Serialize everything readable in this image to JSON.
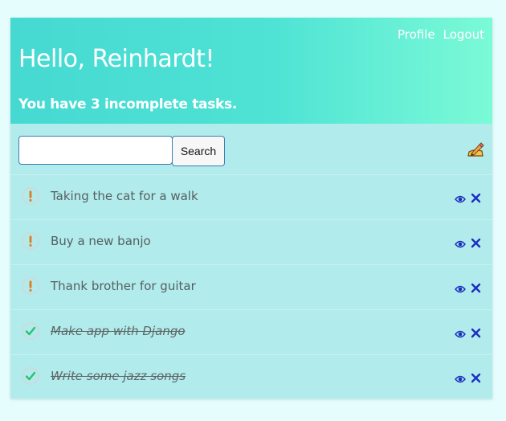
{
  "header": {
    "greeting": "Hello, Reinhardt!",
    "summary": "You have 3 incomplete tasks.",
    "nav": {
      "profile": "Profile",
      "logout": "Logout"
    }
  },
  "search": {
    "value": "",
    "button_label": "Search"
  },
  "toolbar": {
    "edit_icon": "pencil-edit-icon"
  },
  "tasks": [
    {
      "text": "Taking the cat for a walk",
      "complete": false
    },
    {
      "text": "Buy a new banjo",
      "complete": false
    },
    {
      "text": "Thank brother for guitar",
      "complete": false
    },
    {
      "text": "Make app with Django",
      "complete": true
    },
    {
      "text": "Write some jazz songs",
      "complete": true
    }
  ],
  "colors": {
    "header_gradient_start": "#45d9d2",
    "header_gradient_end": "#7bfad6",
    "card_background": "#b2ebec",
    "incomplete_icon": "#e07b20",
    "complete_icon": "#2fbf71",
    "action_icon": "#1a2fbf"
  }
}
